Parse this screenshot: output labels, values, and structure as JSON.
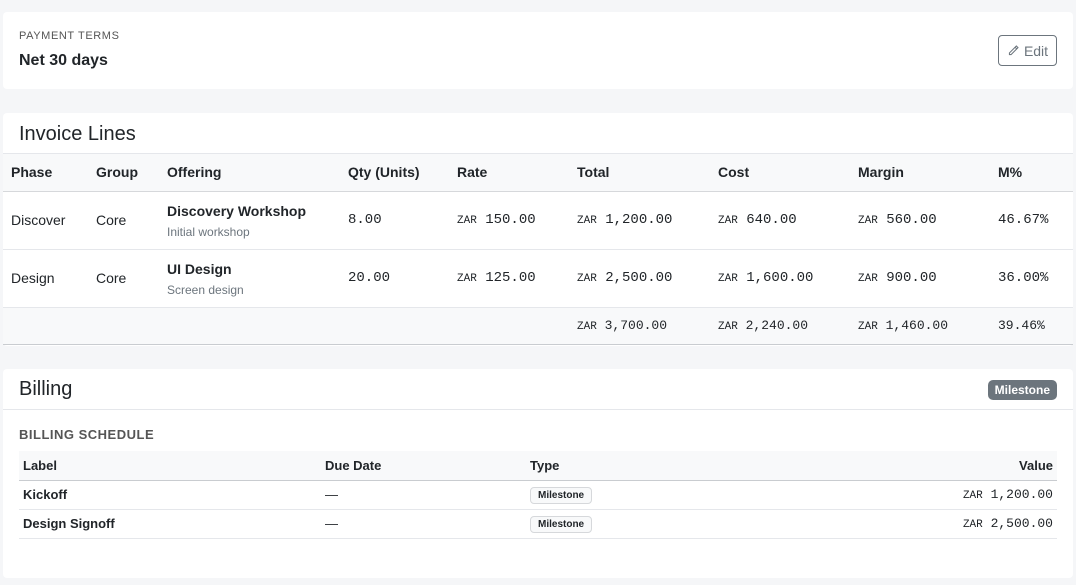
{
  "payment_terms": {
    "label": "PAYMENT TERMS",
    "value": "Net 30 days",
    "edit_label": "Edit"
  },
  "invoice_lines": {
    "title": "Invoice Lines",
    "columns": [
      "Phase",
      "Group",
      "Offering",
      "Qty (Units)",
      "Rate",
      "Total",
      "Cost",
      "Margin",
      "M%"
    ],
    "currency": "ZAR",
    "rows": [
      {
        "phase": "Discover",
        "group": "Core",
        "offering": "Discovery Workshop",
        "description": "Initial workshop",
        "qty": "8.00",
        "rate": "150.00",
        "total": "1,200.00",
        "cost": "640.00",
        "margin": "560.00",
        "mpct": "46.67%"
      },
      {
        "phase": "Design",
        "group": "Core",
        "offering": "UI Design",
        "description": "Screen design",
        "qty": "20.00",
        "rate": "125.00",
        "total": "2,500.00",
        "cost": "1,600.00",
        "margin": "900.00",
        "mpct": "36.00%"
      }
    ],
    "totals": {
      "total": "3,700.00",
      "cost": "2,240.00",
      "margin": "1,460.00",
      "mpct": "39.46%"
    }
  },
  "billing": {
    "title": "Billing",
    "mode_badge": "Milestone",
    "schedule_title": "BILLING SCHEDULE",
    "columns": [
      "Label",
      "Due Date",
      "Type",
      "Value"
    ],
    "currency": "ZAR",
    "rows": [
      {
        "label": "Kickoff",
        "due": "—",
        "type": "Milestone",
        "value": "1,200.00"
      },
      {
        "label": "Design Signoff",
        "due": "—",
        "type": "Milestone",
        "value": "2,500.00"
      }
    ]
  }
}
